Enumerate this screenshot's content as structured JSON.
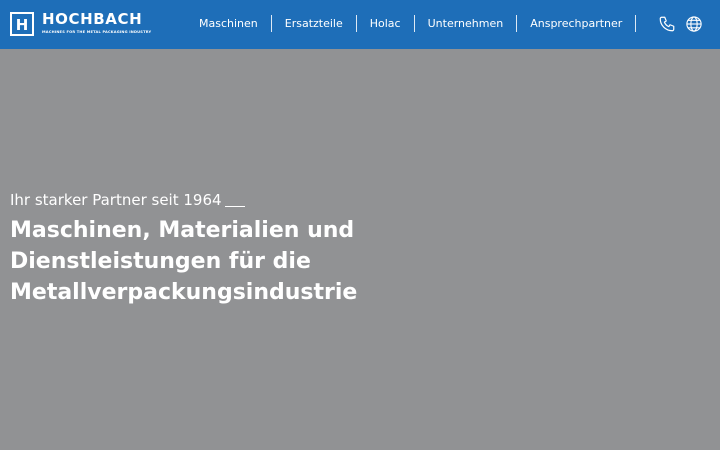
{
  "header": {
    "logo": {
      "name": "HOCHBACH",
      "tagline": "MACHINES FOR THE METAL PACKAGING INDUSTRY",
      "mark_letter": "H",
      "icon": "hochbach-logo-mark"
    },
    "nav": {
      "items": [
        {
          "label": "Maschinen"
        },
        {
          "label": "Ersatzteile"
        },
        {
          "label": "Holac"
        },
        {
          "label": "Unternehmen"
        },
        {
          "label": "Ansprechpartner"
        }
      ]
    },
    "icons": {
      "phone": "phone-icon",
      "language": "globe-icon"
    }
  },
  "hero": {
    "kicker": "Ihr starker Partner seit 1964",
    "title_lines": [
      "Maschinen, Materialien und",
      "Dienstleistungen für die",
      "Metallverpackungsindustrie"
    ]
  },
  "colors": {
    "header_bg": "#1e6eb8",
    "hero_bg": "#919294",
    "text": "#ffffff"
  }
}
